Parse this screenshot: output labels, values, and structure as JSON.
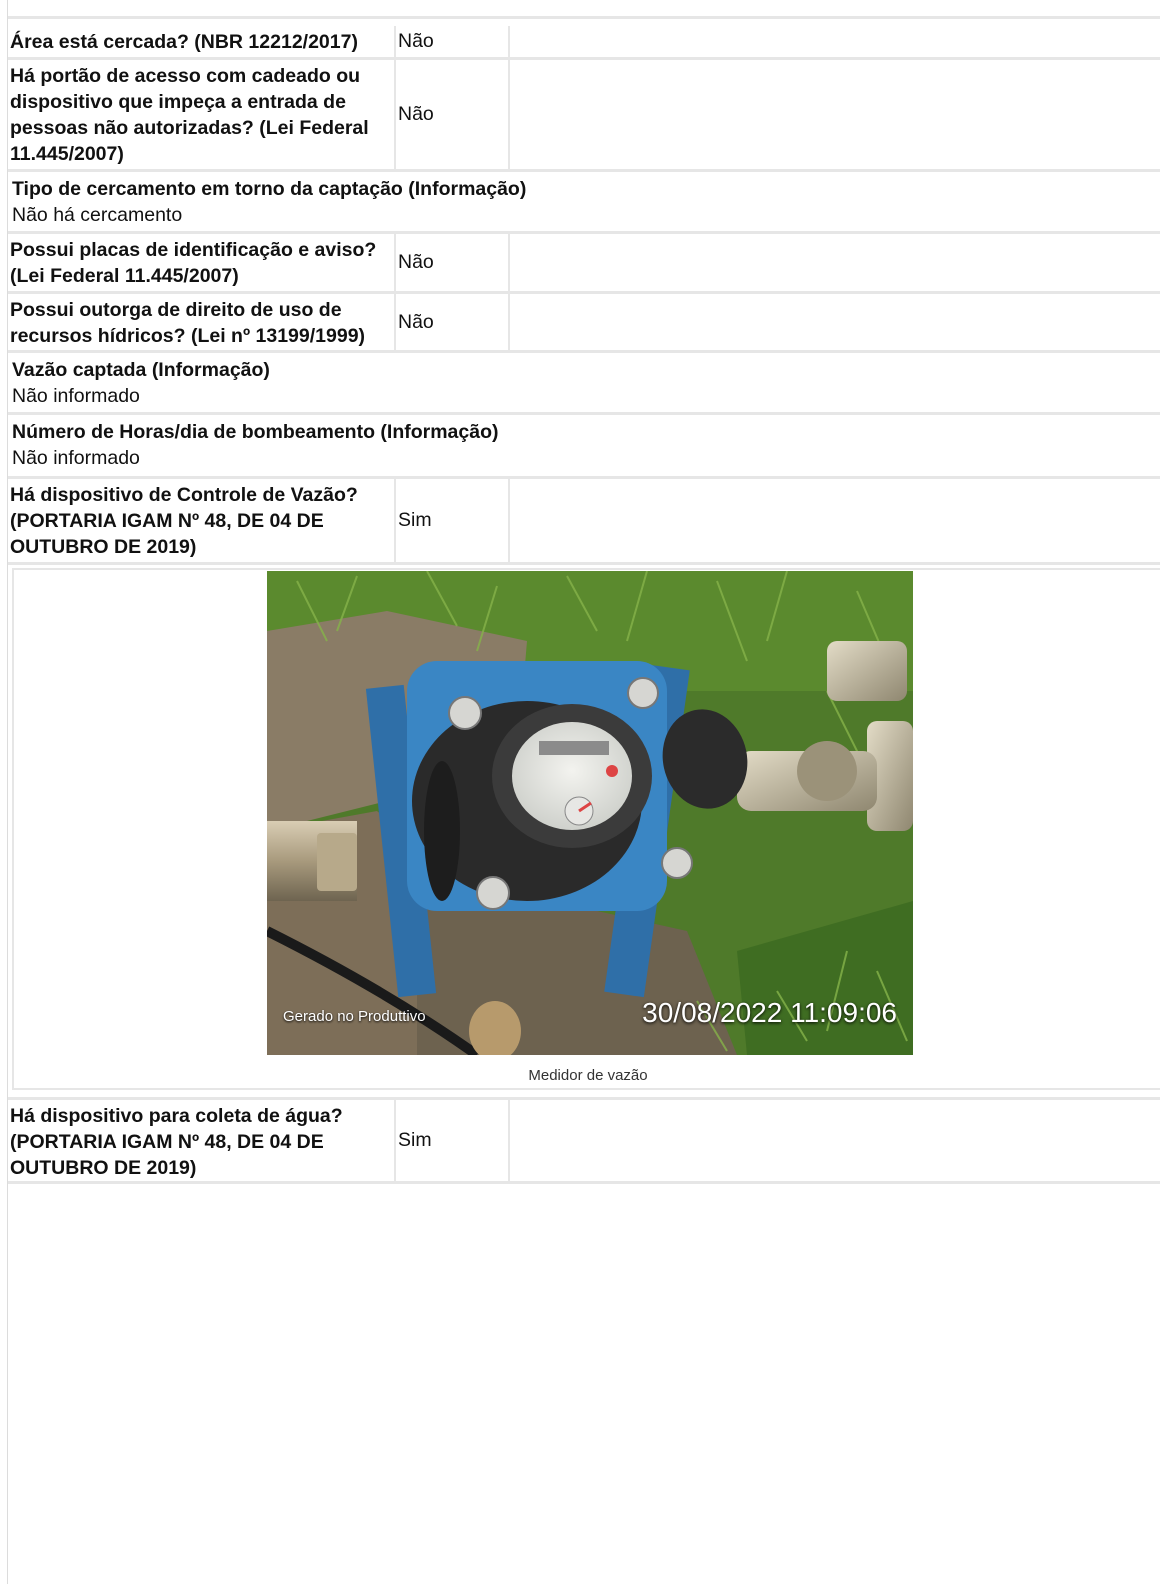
{
  "rows": {
    "q1": {
      "question": "Área está cercada? (NBR 12212/2017)",
      "answer": "Não"
    },
    "q2": {
      "question": "Há portão de acesso com cadeado ou dispositivo que impeça a entrada de pessoas não autorizadas? (Lei Federal 11.445/2007)",
      "answer": "Não"
    },
    "info1": {
      "title": "Tipo de cercamento em torno da captação (Informação)",
      "value": "Não há cercamento"
    },
    "q3": {
      "question": "Possui placas de identificação e aviso? (Lei Federal 11.445/2007)",
      "answer": "Não"
    },
    "q4": {
      "question": "Possui outorga de direito de uso de recursos hídricos? (Lei nº 13199/1999)",
      "answer": "Não"
    },
    "info2": {
      "title": "Vazão captada (Informação)",
      "value": "Não informado"
    },
    "info3": {
      "title": "Número de Horas/dia de bombeamento (Informação)",
      "value": "Não informado"
    },
    "q5": {
      "question": "Há dispositivo de Controle de Vazão? (PORTARIA IGAM Nº 48, DE 04 DE OUTUBRO DE 2019)",
      "answer": "Sim"
    },
    "q6": {
      "question": "Há dispositivo para coleta de água? (PORTARIA IGAM Nº 48, DE 04 DE OUTUBRO DE 2019)",
      "answer": "Sim"
    }
  },
  "photo": {
    "watermark": "Gerado no Produttivo",
    "timestamp": "30/08/2022 11:09:06",
    "caption": "Medidor de vazão"
  },
  "colors": {
    "border": "#e6e6e6",
    "text": "#111111",
    "grass": "#4f7a2a",
    "meter_body": "#2f6fa8"
  }
}
